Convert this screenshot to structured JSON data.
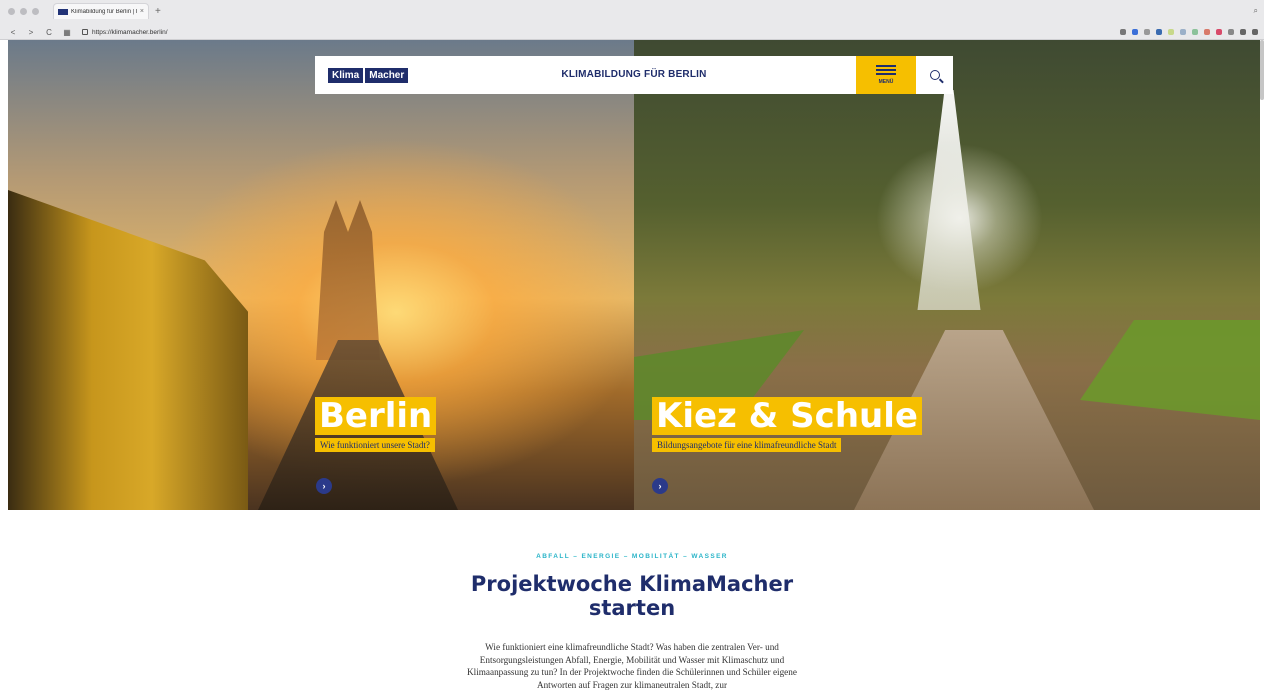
{
  "browser": {
    "tab_title": "Klimabildung für Berlin | Infra...",
    "tab_close": "×",
    "new_tab": "+",
    "back": "<",
    "forward": ">",
    "reload": "C",
    "url": "https://klimamacher.berlin/"
  },
  "site": {
    "logo_part1": "Klima",
    "logo_part2": "Macher",
    "title": "KLIMABILDUNG FÜR BERLIN",
    "menu_label": "MENÜ"
  },
  "cards": [
    {
      "title": "Berlin",
      "subtitle": "Wie funktioniert unsere Stadt?",
      "arrow": "›"
    },
    {
      "title": "Kiez & Schule",
      "subtitle": "Bildungsangebote für eine klimafreundliche Stadt",
      "arrow": "›"
    }
  ],
  "content": {
    "eyebrow": "ABFALL – ENERGIE – MOBILITÄT – WASSER",
    "headline": "Projektwoche KlimaMacher starten",
    "body": "Wie funktioniert eine klimafreundliche Stadt? Was haben die zentralen Ver- und Entsorgungsleistungen Abfall, Energie, Mobilität und Wasser mit Klimaschutz und Klimaanpassung zu tun? In der Projektwoche finden die Schülerinnen und Schüler eigene Antworten auf Fragen zur klimaneutralen Stadt, zur"
  },
  "colors": {
    "accent_yellow": "#f6bf00",
    "brand_navy": "#1f2d6b",
    "eyebrow_teal": "#29b4c8"
  }
}
